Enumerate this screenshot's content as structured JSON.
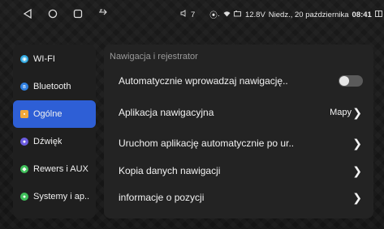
{
  "statusbar": {
    "usb_icon": "usb-icon",
    "volume": "7",
    "network": "⦿·",
    "voltage": "12.8V",
    "date": "Niedz., 20 października",
    "time": "08:41"
  },
  "sidebar": {
    "items": [
      {
        "label": "WI-FI",
        "icon": "wifi-icon",
        "color": "#2fa8e0"
      },
      {
        "label": "Bluetooth",
        "icon": "bluetooth-icon",
        "color": "#2f7fe0"
      },
      {
        "label": "Ogólne",
        "icon": "general-icon",
        "color": "#f2a83a"
      },
      {
        "label": "Dźwięk",
        "icon": "sound-icon",
        "color": "#6b5ce0"
      },
      {
        "label": "Rewers i AUX",
        "icon": "reverse-icon",
        "color": "#3fbf5a"
      },
      {
        "label": "Systemy i ap..",
        "icon": "apps-icon",
        "color": "#3fbf5a"
      }
    ],
    "active_index": 2
  },
  "panel": {
    "title": "Nawigacja i rejestrator",
    "rows": [
      {
        "label": "Automatycznie wprowadzaj nawigację..",
        "type": "toggle",
        "toggle_on": false
      },
      {
        "label": "Aplikacja nawigacyjna",
        "type": "value",
        "value": "Mapy"
      },
      {
        "label": "Uruchom aplikację automatycznie po ur..",
        "type": "chevron"
      },
      {
        "label": "Kopia danych nawigacji",
        "type": "chevron"
      },
      {
        "label": "informacje o pozycji",
        "type": "chevron"
      }
    ]
  },
  "colors": {
    "accent": "#2e5fd6"
  }
}
